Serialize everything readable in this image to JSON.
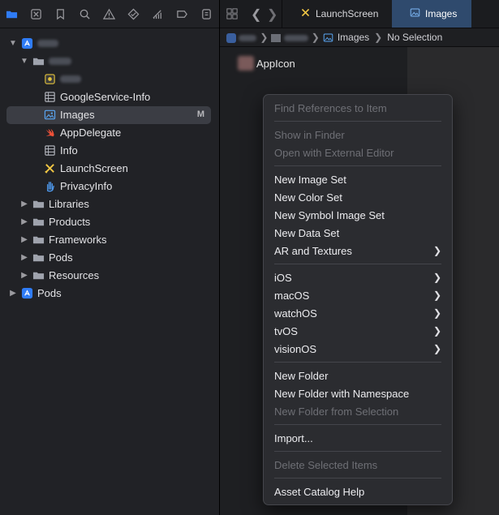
{
  "navigator": {
    "toolbar_icons": [
      "folder-icon",
      "source-control-icon",
      "bookmark-icon",
      "search-icon",
      "warning-icon",
      "test-icon",
      "debug-icon",
      "breakpoint-icon",
      "report-icon"
    ],
    "items": [
      {
        "label": "",
        "kind": "project",
        "blurred": true
      },
      {
        "label": "",
        "kind": "folder",
        "blurred": true
      },
      {
        "label": "",
        "kind": "file",
        "blurred": true
      },
      {
        "label": "GoogleService-Info",
        "kind": "plist"
      },
      {
        "label": "Images",
        "kind": "assets",
        "badge": "M"
      },
      {
        "label": "AppDelegate",
        "kind": "swift"
      },
      {
        "label": "Info",
        "kind": "plist"
      },
      {
        "label": "LaunchScreen",
        "kind": "storyboard"
      },
      {
        "label": "PrivacyInfo",
        "kind": "privacy"
      },
      {
        "label": "Libraries",
        "kind": "group"
      },
      {
        "label": "Products",
        "kind": "group"
      },
      {
        "label": "Frameworks",
        "kind": "group"
      },
      {
        "label": "Pods",
        "kind": "group"
      },
      {
        "label": "Resources",
        "kind": "group"
      },
      {
        "label": "Pods",
        "kind": "project"
      }
    ]
  },
  "editor": {
    "tabs": [
      {
        "label": "LaunchScreen",
        "active": false
      },
      {
        "label": "Images",
        "active": true
      }
    ],
    "breadcrumb": {
      "images": "Images",
      "selection": "No Selection"
    },
    "assets": [
      {
        "label": "AppIcon"
      }
    ]
  },
  "context_menu": {
    "items": [
      {
        "label": "Find References to Item",
        "disabled": true
      },
      {
        "sep": true
      },
      {
        "label": "Show in Finder",
        "disabled": true
      },
      {
        "label": "Open with External Editor",
        "disabled": true
      },
      {
        "sep": true
      },
      {
        "label": "New Image Set"
      },
      {
        "label": "New Color Set"
      },
      {
        "label": "New Symbol Image Set"
      },
      {
        "label": "New Data Set"
      },
      {
        "label": "AR and Textures",
        "submenu": true
      },
      {
        "sep": true
      },
      {
        "label": "iOS",
        "submenu": true
      },
      {
        "label": "macOS",
        "submenu": true
      },
      {
        "label": "watchOS",
        "submenu": true
      },
      {
        "label": "tvOS",
        "submenu": true
      },
      {
        "label": "visionOS",
        "submenu": true
      },
      {
        "sep": true
      },
      {
        "label": "New Folder"
      },
      {
        "label": "New Folder with Namespace"
      },
      {
        "label": "New Folder from Selection",
        "disabled": true
      },
      {
        "sep": true
      },
      {
        "label": "Import..."
      },
      {
        "sep": true
      },
      {
        "label": "Delete Selected Items",
        "disabled": true
      },
      {
        "sep": true
      },
      {
        "label": "Asset Catalog Help"
      }
    ]
  },
  "colors": {
    "accent": "#2f7cf6",
    "selection": "#3b3d44",
    "active_tab": "#2f4a6d",
    "swift": "#f05138",
    "storyboard": "#f2c744"
  }
}
